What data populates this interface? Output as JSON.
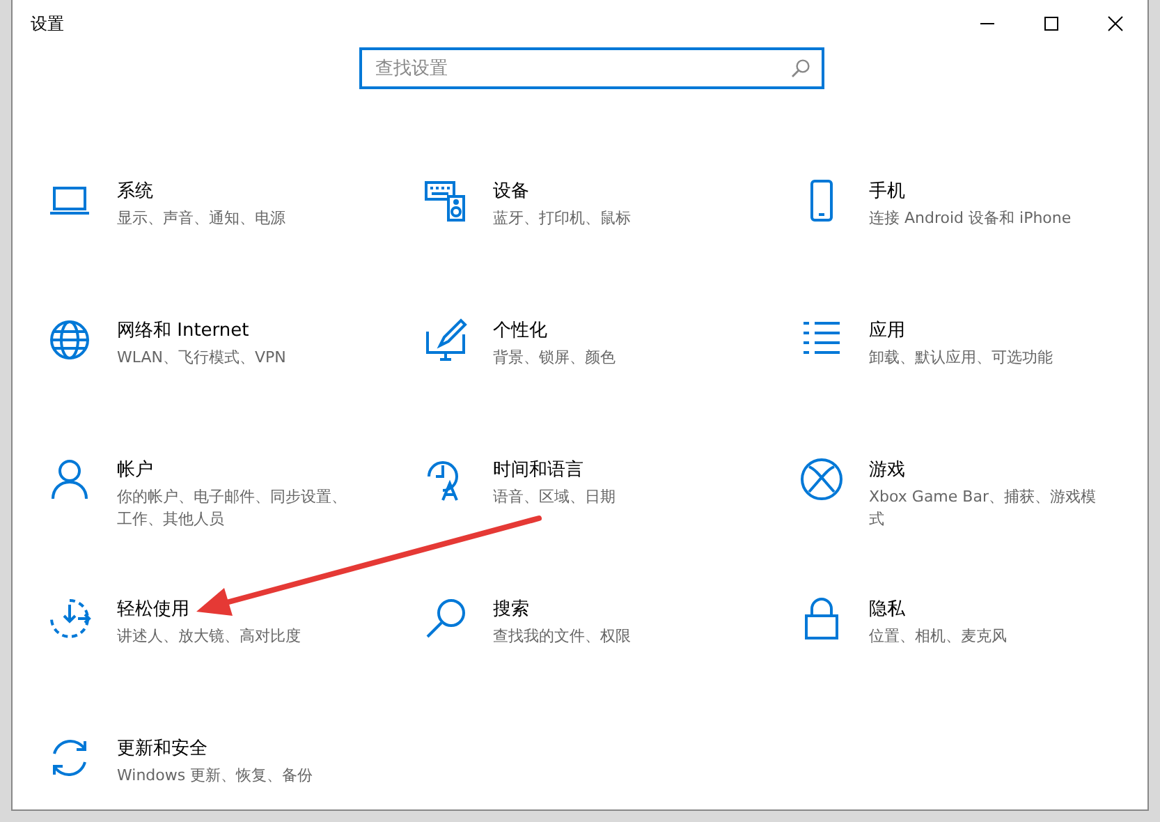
{
  "window": {
    "title": "设置"
  },
  "search": {
    "placeholder": "查找设置"
  },
  "categories": [
    {
      "kind": "system",
      "title": "系统",
      "description": "显示、声音、通知、电源"
    },
    {
      "kind": "devices",
      "title": "设备",
      "description": "蓝牙、打印机、鼠标"
    },
    {
      "kind": "phone",
      "title": "手机",
      "description": "连接 Android 设备和 iPhone"
    },
    {
      "kind": "network",
      "title": "网络和 Internet",
      "description": "WLAN、飞行模式、VPN"
    },
    {
      "kind": "personalization",
      "title": "个性化",
      "description": "背景、锁屏、颜色"
    },
    {
      "kind": "apps",
      "title": "应用",
      "description": "卸载、默认应用、可选功能"
    },
    {
      "kind": "accounts",
      "title": "帐户",
      "description": "你的帐户、电子邮件、同步设置、工作、其他人员"
    },
    {
      "kind": "time",
      "title": "时间和语言",
      "description": "语音、区域、日期"
    },
    {
      "kind": "gaming",
      "title": "游戏",
      "description": "Xbox Game Bar、捕获、游戏模式"
    },
    {
      "kind": "ease",
      "title": "轻松使用",
      "description": "讲述人、放大镜、高对比度"
    },
    {
      "kind": "search",
      "title": "搜索",
      "description": "查找我的文件、权限"
    },
    {
      "kind": "privacy",
      "title": "隐私",
      "description": "位置、相机、麦克风"
    },
    {
      "kind": "update",
      "title": "更新和安全",
      "description": "Windows 更新、恢复、备份"
    }
  ]
}
